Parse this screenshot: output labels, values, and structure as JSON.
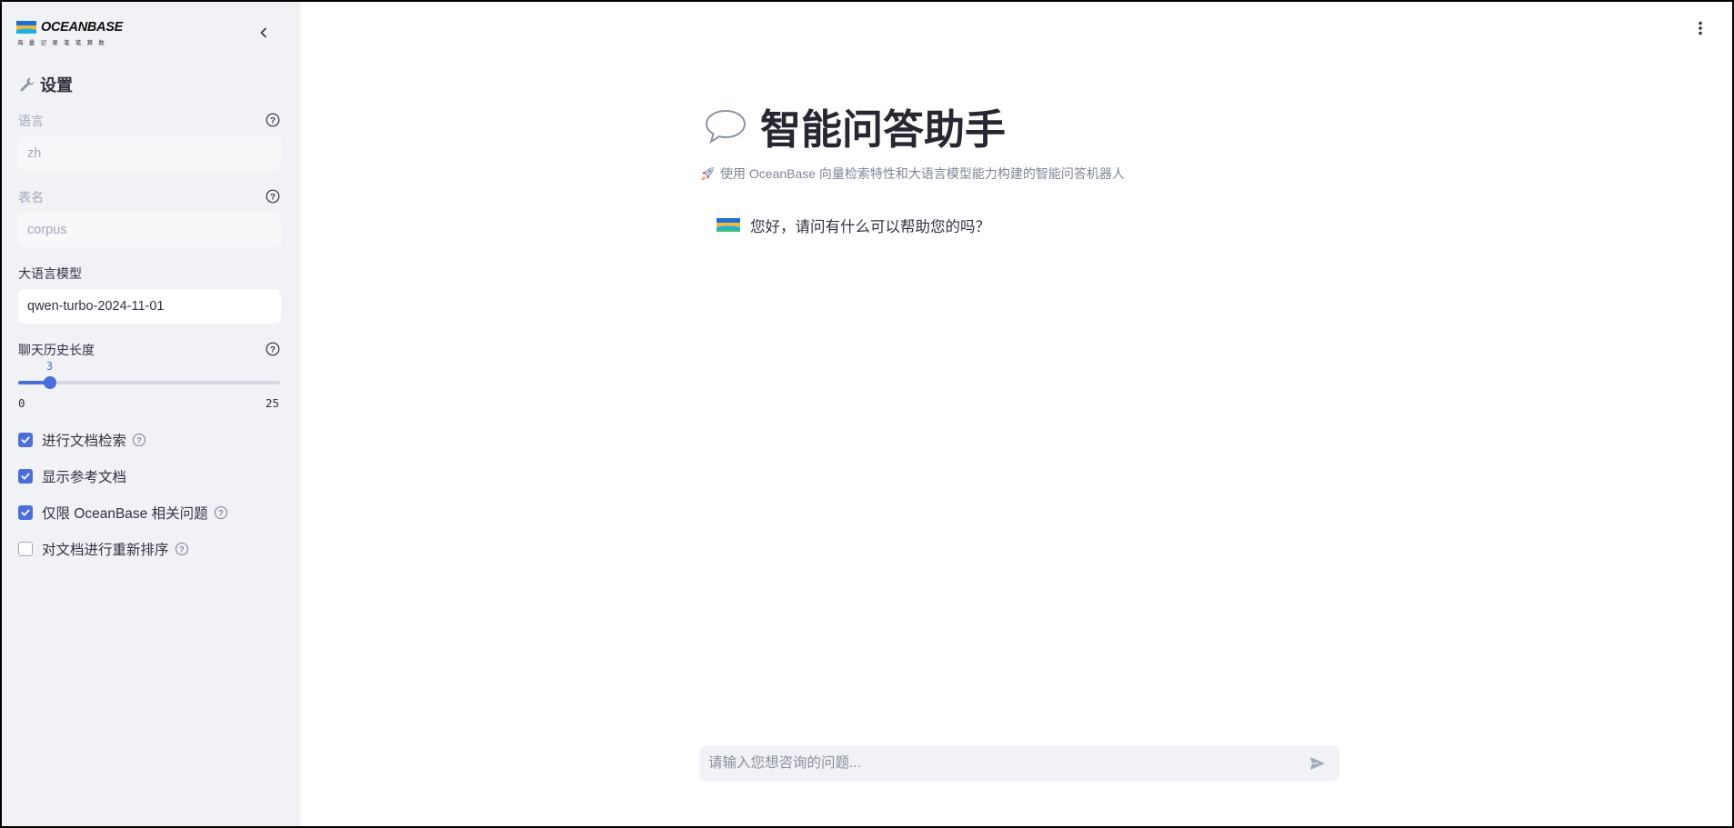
{
  "sidebar": {
    "logo": {
      "brand": "OCEANBASE",
      "tagline": "海 量 记 录   笔 笔 算 数"
    },
    "settings_title": "设置",
    "fields": {
      "language": {
        "label": "语言",
        "value": "zh"
      },
      "table_name": {
        "label": "表名",
        "value": "corpus"
      },
      "llm_model": {
        "label": "大语言模型",
        "value": "qwen-turbo-2024-11-01"
      }
    },
    "history_slider": {
      "label": "聊天历史长度",
      "value": 3,
      "min": 0,
      "max": 25,
      "value_text": "3",
      "min_text": "0",
      "max_text": "25"
    },
    "checkboxes": [
      {
        "label": "进行文档检索",
        "checked": true,
        "has_help": true
      },
      {
        "label": "显示参考文档",
        "checked": true,
        "has_help": false
      },
      {
        "label": "仅限 OceanBase 相关问题",
        "checked": true,
        "has_help": true
      },
      {
        "label": "对文档进行重新排序",
        "checked": false,
        "has_help": true
      }
    ]
  },
  "main": {
    "title": "智能问答助手",
    "subtitle": "使用 OceanBase 向量检索特性和大语言模型能力构建的智能问答机器人",
    "messages": [
      {
        "role": "assistant",
        "text": "您好，请问有什么可以帮助您的吗？"
      }
    ],
    "chat_input": {
      "placeholder": "请输入您想咨询的问题...",
      "value": ""
    }
  },
  "colors": {
    "accent": "#4a6fdc",
    "sidebar_bg": "#f0f2f6",
    "text": "#31333f",
    "muted": "#808495"
  }
}
